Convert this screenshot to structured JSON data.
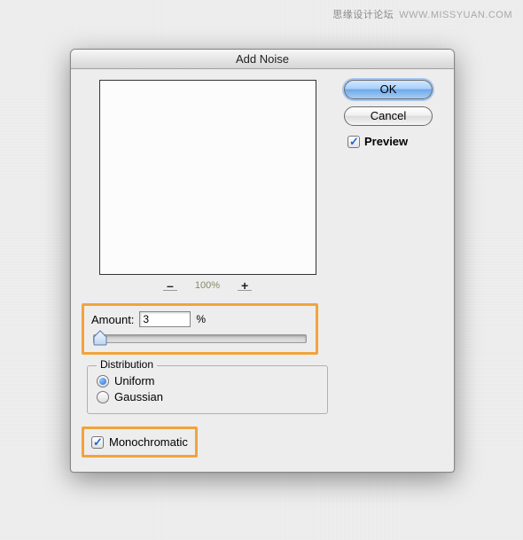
{
  "watermark": {
    "cn": "思缘设计论坛",
    "en": "WWW.MISSYUAN.COM"
  },
  "dialog": {
    "title": "Add Noise",
    "buttons": {
      "ok": "OK",
      "cancel": "Cancel"
    },
    "preview_checkbox": {
      "label": "Preview",
      "checked": true
    },
    "zoom": {
      "minus": "–",
      "label": "100%",
      "plus": "+"
    },
    "amount": {
      "label": "Amount:",
      "value": "3",
      "unit": "%"
    },
    "distribution": {
      "legend": "Distribution",
      "uniform": {
        "label": "Uniform",
        "checked": true
      },
      "gaussian": {
        "label": "Gaussian",
        "checked": false
      }
    },
    "monochromatic": {
      "label": "Monochromatic",
      "checked": true
    }
  }
}
